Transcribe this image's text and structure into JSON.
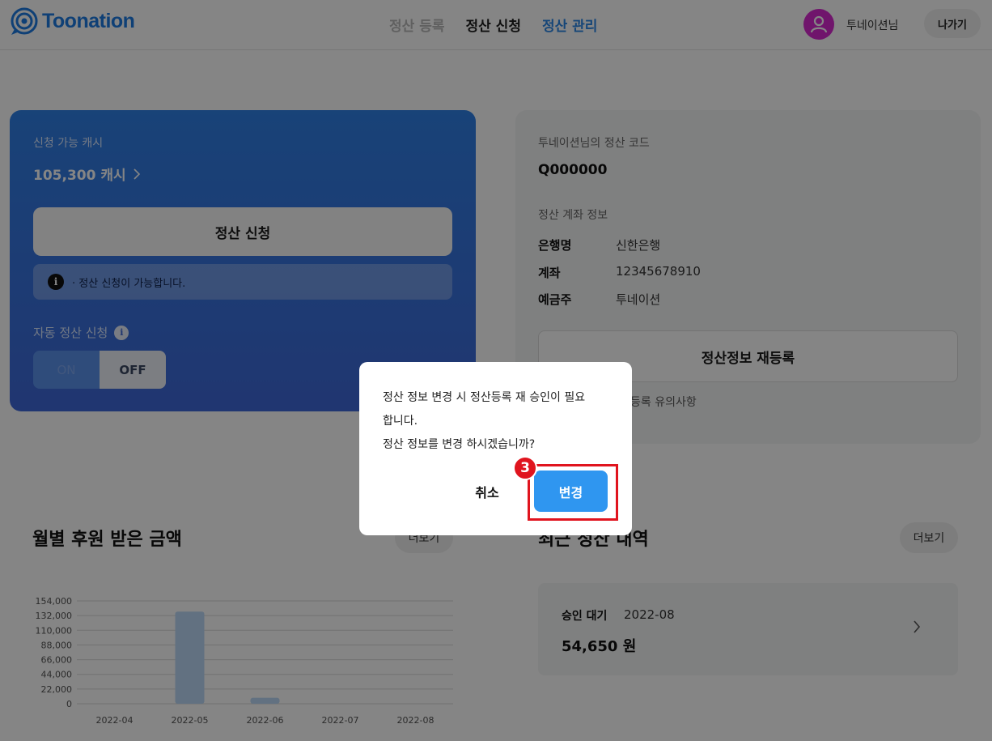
{
  "header": {
    "logo_text": "Toonation",
    "nav": [
      "정산 등록",
      "정산 신청",
      "정산 관리"
    ],
    "username": "투네이션님",
    "exit_label": "나가기"
  },
  "cash_card": {
    "label": "신청 가능 캐시",
    "amount": "105,300 캐시",
    "apply_label": "정산 신청",
    "notice": "· 정산 신청이 가능합니다.",
    "auto_label": "자동 정산 신청",
    "toggle_on": "ON",
    "toggle_off": "OFF"
  },
  "info_card": {
    "code_label": "투네이션님의 정산 코드",
    "code_value": "Q000000",
    "account_label": "정산 계좌 정보",
    "rows": [
      {
        "key": "은행명",
        "value": "신한은행"
      },
      {
        "key": "계좌",
        "value": "12345678910"
      },
      {
        "key": "예금주",
        "value": "투네이션"
      }
    ],
    "rereg_label": "정산정보 재등록",
    "rereg_note": "등록 유의사항"
  },
  "monthly": {
    "title": "월별 후원 받은 금액",
    "more_label": "더보기"
  },
  "history": {
    "title": "최근 정산 내역",
    "more_label": "더보기",
    "status": "승인 대기",
    "month": "2022-08",
    "amount": "54,650 원"
  },
  "chart_data": {
    "type": "bar",
    "categories": [
      "2022-04",
      "2022-05",
      "2022-06",
      "2022-07",
      "2022-08"
    ],
    "values": [
      0,
      138000,
      9000,
      0,
      0
    ],
    "ylim": [
      0,
      154000
    ],
    "yticks": [
      0,
      22000,
      44000,
      66000,
      88000,
      110000,
      132000,
      154000
    ],
    "ytick_labels": [
      "0",
      "22,000",
      "44,000",
      "66,000",
      "88,000",
      "110,000",
      "132,000",
      "154,000"
    ],
    "bar_color": "#bcd9f7",
    "grid": true
  },
  "dialog": {
    "message_line1": "정산 정보 변경 시 정산등록 재 승인이 필요",
    "message_line2": "합니다.",
    "message_line3": "정산 정보를 변경 하시겠습니까?",
    "cancel_label": "취소",
    "confirm_label": "변경",
    "step_number": "3"
  },
  "colors": {
    "brand": "#1d7be3",
    "confirm": "#2f96f0",
    "highlight": "#e0141e"
  }
}
